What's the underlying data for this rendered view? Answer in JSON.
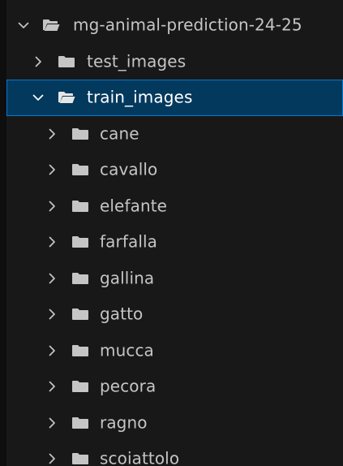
{
  "colors": {
    "background": "#181818",
    "selection_background": "#04395e",
    "selection_border": "#0078d4",
    "text": "#c5c5c5",
    "folder": "#c5c5c5"
  },
  "tree": {
    "root": {
      "label": "mg-animal-prediction-24-25",
      "expanded": true,
      "icon": "folder-open-icon"
    },
    "children": [
      {
        "label": "test_images",
        "expanded": false,
        "icon": "folder-icon"
      },
      {
        "label": "train_images",
        "expanded": true,
        "selected": true,
        "icon": "folder-open-icon"
      }
    ],
    "train_images_children": [
      {
        "label": "cane"
      },
      {
        "label": "cavallo"
      },
      {
        "label": "elefante"
      },
      {
        "label": "farfalla"
      },
      {
        "label": "gallina"
      },
      {
        "label": "gatto"
      },
      {
        "label": "mucca"
      },
      {
        "label": "pecora"
      },
      {
        "label": "ragno"
      },
      {
        "label": "scoiattolo"
      }
    ]
  }
}
